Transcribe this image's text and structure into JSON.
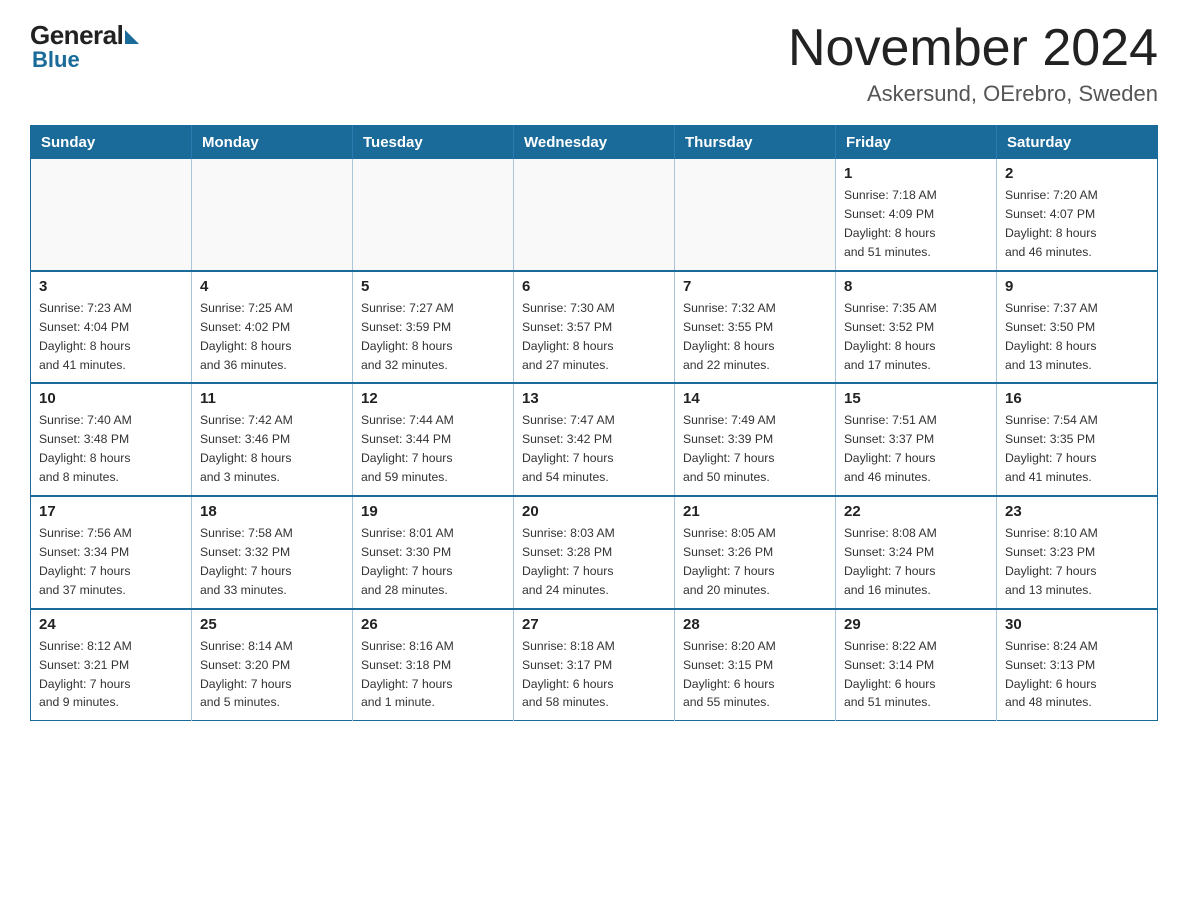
{
  "logo": {
    "general": "General",
    "blue": "Blue"
  },
  "header": {
    "month": "November 2024",
    "location": "Askersund, OErebro, Sweden"
  },
  "weekdays": [
    "Sunday",
    "Monday",
    "Tuesday",
    "Wednesday",
    "Thursday",
    "Friday",
    "Saturday"
  ],
  "weeks": [
    [
      {
        "day": "",
        "info": ""
      },
      {
        "day": "",
        "info": ""
      },
      {
        "day": "",
        "info": ""
      },
      {
        "day": "",
        "info": ""
      },
      {
        "day": "",
        "info": ""
      },
      {
        "day": "1",
        "info": "Sunrise: 7:18 AM\nSunset: 4:09 PM\nDaylight: 8 hours\nand 51 minutes."
      },
      {
        "day": "2",
        "info": "Sunrise: 7:20 AM\nSunset: 4:07 PM\nDaylight: 8 hours\nand 46 minutes."
      }
    ],
    [
      {
        "day": "3",
        "info": "Sunrise: 7:23 AM\nSunset: 4:04 PM\nDaylight: 8 hours\nand 41 minutes."
      },
      {
        "day": "4",
        "info": "Sunrise: 7:25 AM\nSunset: 4:02 PM\nDaylight: 8 hours\nand 36 minutes."
      },
      {
        "day": "5",
        "info": "Sunrise: 7:27 AM\nSunset: 3:59 PM\nDaylight: 8 hours\nand 32 minutes."
      },
      {
        "day": "6",
        "info": "Sunrise: 7:30 AM\nSunset: 3:57 PM\nDaylight: 8 hours\nand 27 minutes."
      },
      {
        "day": "7",
        "info": "Sunrise: 7:32 AM\nSunset: 3:55 PM\nDaylight: 8 hours\nand 22 minutes."
      },
      {
        "day": "8",
        "info": "Sunrise: 7:35 AM\nSunset: 3:52 PM\nDaylight: 8 hours\nand 17 minutes."
      },
      {
        "day": "9",
        "info": "Sunrise: 7:37 AM\nSunset: 3:50 PM\nDaylight: 8 hours\nand 13 minutes."
      }
    ],
    [
      {
        "day": "10",
        "info": "Sunrise: 7:40 AM\nSunset: 3:48 PM\nDaylight: 8 hours\nand 8 minutes."
      },
      {
        "day": "11",
        "info": "Sunrise: 7:42 AM\nSunset: 3:46 PM\nDaylight: 8 hours\nand 3 minutes."
      },
      {
        "day": "12",
        "info": "Sunrise: 7:44 AM\nSunset: 3:44 PM\nDaylight: 7 hours\nand 59 minutes."
      },
      {
        "day": "13",
        "info": "Sunrise: 7:47 AM\nSunset: 3:42 PM\nDaylight: 7 hours\nand 54 minutes."
      },
      {
        "day": "14",
        "info": "Sunrise: 7:49 AM\nSunset: 3:39 PM\nDaylight: 7 hours\nand 50 minutes."
      },
      {
        "day": "15",
        "info": "Sunrise: 7:51 AM\nSunset: 3:37 PM\nDaylight: 7 hours\nand 46 minutes."
      },
      {
        "day": "16",
        "info": "Sunrise: 7:54 AM\nSunset: 3:35 PM\nDaylight: 7 hours\nand 41 minutes."
      }
    ],
    [
      {
        "day": "17",
        "info": "Sunrise: 7:56 AM\nSunset: 3:34 PM\nDaylight: 7 hours\nand 37 minutes."
      },
      {
        "day": "18",
        "info": "Sunrise: 7:58 AM\nSunset: 3:32 PM\nDaylight: 7 hours\nand 33 minutes."
      },
      {
        "day": "19",
        "info": "Sunrise: 8:01 AM\nSunset: 3:30 PM\nDaylight: 7 hours\nand 28 minutes."
      },
      {
        "day": "20",
        "info": "Sunrise: 8:03 AM\nSunset: 3:28 PM\nDaylight: 7 hours\nand 24 minutes."
      },
      {
        "day": "21",
        "info": "Sunrise: 8:05 AM\nSunset: 3:26 PM\nDaylight: 7 hours\nand 20 minutes."
      },
      {
        "day": "22",
        "info": "Sunrise: 8:08 AM\nSunset: 3:24 PM\nDaylight: 7 hours\nand 16 minutes."
      },
      {
        "day": "23",
        "info": "Sunrise: 8:10 AM\nSunset: 3:23 PM\nDaylight: 7 hours\nand 13 minutes."
      }
    ],
    [
      {
        "day": "24",
        "info": "Sunrise: 8:12 AM\nSunset: 3:21 PM\nDaylight: 7 hours\nand 9 minutes."
      },
      {
        "day": "25",
        "info": "Sunrise: 8:14 AM\nSunset: 3:20 PM\nDaylight: 7 hours\nand 5 minutes."
      },
      {
        "day": "26",
        "info": "Sunrise: 8:16 AM\nSunset: 3:18 PM\nDaylight: 7 hours\nand 1 minute."
      },
      {
        "day": "27",
        "info": "Sunrise: 8:18 AM\nSunset: 3:17 PM\nDaylight: 6 hours\nand 58 minutes."
      },
      {
        "day": "28",
        "info": "Sunrise: 8:20 AM\nSunset: 3:15 PM\nDaylight: 6 hours\nand 55 minutes."
      },
      {
        "day": "29",
        "info": "Sunrise: 8:22 AM\nSunset: 3:14 PM\nDaylight: 6 hours\nand 51 minutes."
      },
      {
        "day": "30",
        "info": "Sunrise: 8:24 AM\nSunset: 3:13 PM\nDaylight: 6 hours\nand 48 minutes."
      }
    ]
  ]
}
